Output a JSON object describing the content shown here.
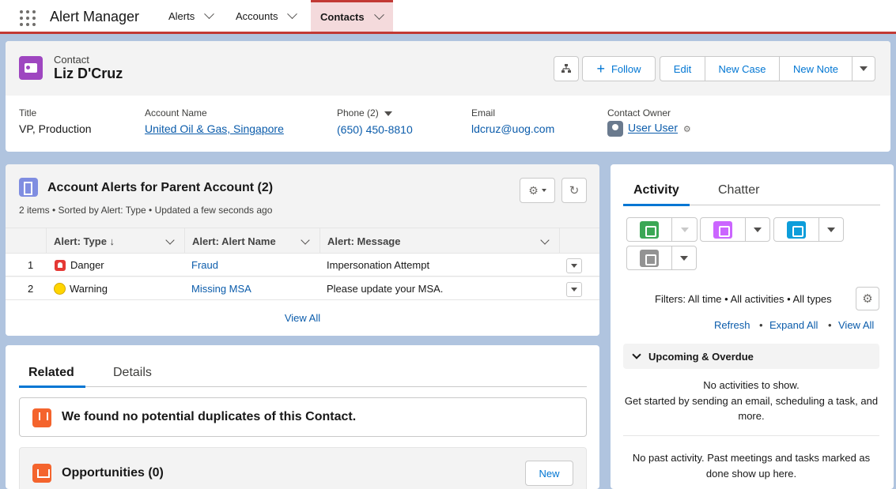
{
  "nav": {
    "app_name": "Alert Manager",
    "tabs": [
      {
        "label": "Alerts"
      },
      {
        "label": "Accounts"
      },
      {
        "label": "Contacts"
      }
    ],
    "accent_color": "#c23934"
  },
  "header": {
    "object_type": "Contact",
    "record_name": "Liz D'Cruz",
    "follow_label": "Follow",
    "edit_label": "Edit",
    "new_case_label": "New Case",
    "new_note_label": "New Note",
    "fields": {
      "title_label": "Title",
      "title_value": "VP, Production",
      "account_label": "Account Name",
      "account_value": "United Oil & Gas, Singapore",
      "phone_label": "Phone (2)",
      "phone_value": "(650) 450-8810",
      "email_label": "Email",
      "email_value": "ldcruz@uog.com",
      "owner_label": "Contact Owner",
      "owner_value": "User User"
    }
  },
  "alerts": {
    "title": "Account Alerts for Parent Account (2)",
    "subtitle": "2 items • Sorted by Alert: Type • Updated a few seconds ago",
    "columns": [
      "Alert: Type ↓",
      "Alert: Alert Name",
      "Alert: Message"
    ],
    "rows": [
      {
        "num": "1",
        "type": "Danger",
        "name": "Fraud",
        "message": "Impersonation Attempt"
      },
      {
        "num": "2",
        "type": "Warning",
        "name": "Missing MSA",
        "message": "Please update your MSA."
      }
    ],
    "view_all": "View All"
  },
  "related": {
    "tabs": [
      "Related",
      "Details"
    ],
    "duplicates": "We found no potential duplicates of this Contact.",
    "opportunities_title": "Opportunities (0)",
    "new_label": "New"
  },
  "activity": {
    "tabs": [
      "Activity",
      "Chatter"
    ],
    "quick_actions": [
      {
        "icon": "task-icon",
        "color": "#3ba755"
      },
      {
        "icon": "event-icon",
        "color": "#cb65ff"
      },
      {
        "icon": "call-icon",
        "color": "#0d9dda"
      },
      {
        "icon": "email-icon",
        "color": "#939393"
      }
    ],
    "filters": "Filters: All time • All activities • All types",
    "links": [
      "Refresh",
      "Expand All",
      "View All"
    ],
    "upcoming_title": "Upcoming & Overdue",
    "no_activities": "No activities to show.",
    "no_activities_hint": "Get started by sending an email, scheduling a task, and more.",
    "past": "No past activity. Past meetings and tasks marked as done show up here."
  }
}
